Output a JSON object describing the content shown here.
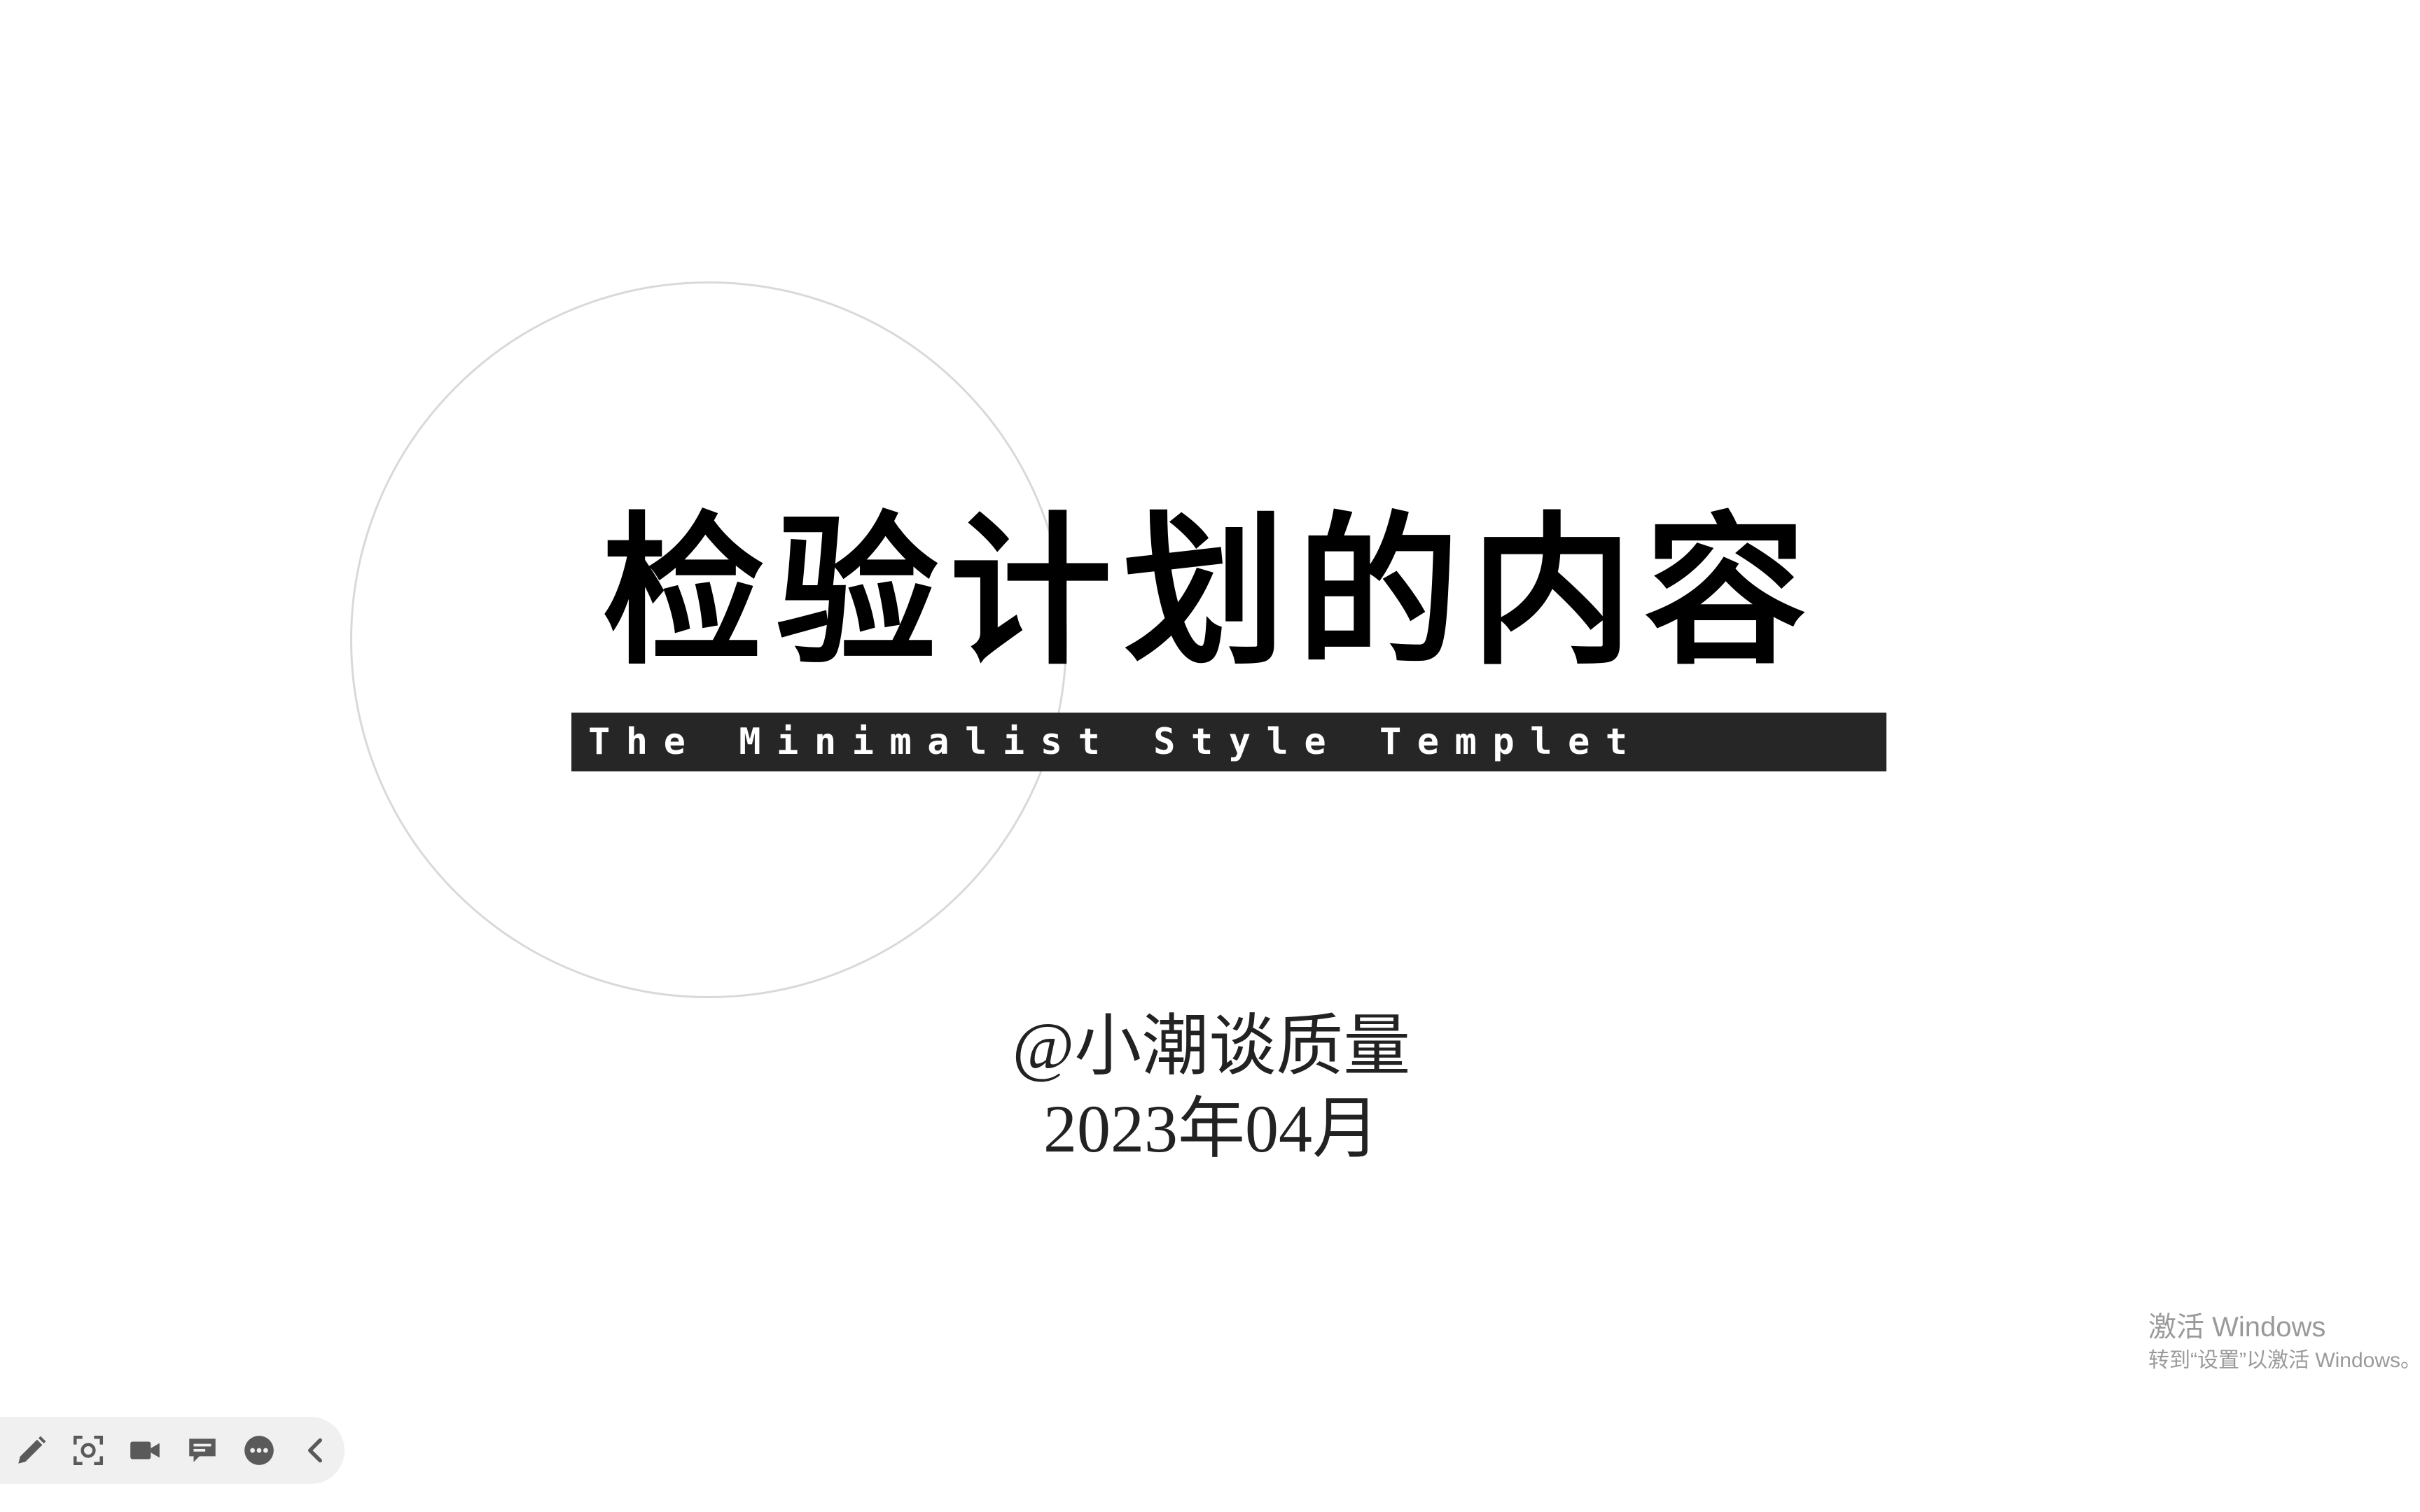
{
  "slide": {
    "title": "检验计划的内容",
    "subtitle": "The Minimalist Style Templet",
    "author": "@小潮谈质量",
    "date": "2023年04月"
  },
  "watermark": {
    "title": "激活 Windows",
    "subtitle": "转到“设置”以激活 Windows。"
  },
  "toolbar": {
    "buttons": [
      {
        "name": "pen",
        "icon": "pencil-icon"
      },
      {
        "name": "screenshot",
        "icon": "screenshot-icon"
      },
      {
        "name": "record",
        "icon": "video-camera-icon"
      },
      {
        "name": "comment",
        "icon": "comment-icon"
      },
      {
        "name": "more",
        "icon": "more-icon"
      },
      {
        "name": "collapse",
        "icon": "chevron-left-icon"
      }
    ]
  },
  "colors": {
    "background": "#ffffff",
    "title_text": "#000000",
    "subtitle_bar": "#262626",
    "subtitle_text": "#ffffff",
    "circle_outline": "#d9d9d9",
    "toolbar_bg": "#f0f0f0",
    "toolbar_icon": "#5a5a5a",
    "watermark_text": "#9a9a9a"
  }
}
